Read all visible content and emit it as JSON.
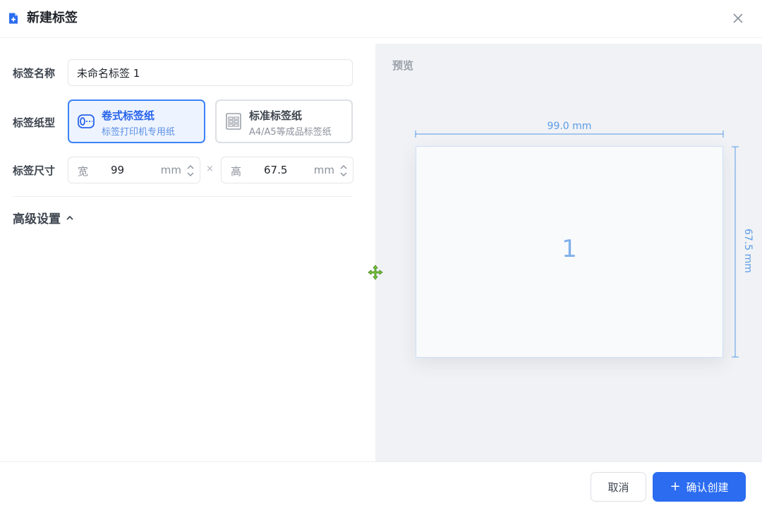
{
  "header": {
    "title": "新建标签",
    "icon": "add-file-icon",
    "close_icon": "close-icon"
  },
  "form": {
    "name_label": "标签名称",
    "name_value": "未命名标签 1",
    "paper_label": "标签纸型",
    "paper_options": [
      {
        "title": "卷式标签纸",
        "subtitle": "标签打印机专用纸",
        "icon": "roll-paper-icon",
        "selected": true
      },
      {
        "title": "标准标签纸",
        "subtitle": "A4/A5等成品标签纸",
        "icon": "sheet-paper-icon",
        "selected": false
      }
    ],
    "size_label": "标签尺寸",
    "width": {
      "prefix": "宽",
      "value": "99",
      "unit": "mm"
    },
    "separator": "×",
    "height": {
      "prefix": "高",
      "value": "67.5",
      "unit": "mm"
    },
    "advanced_label": "高级设置"
  },
  "preview": {
    "label": "预览",
    "width_text": "99.0 mm",
    "height_text": "67.5 mm",
    "label_number": "1"
  },
  "footer": {
    "cancel_label": "取消",
    "confirm_plus": "+",
    "confirm_label": "确认创建"
  },
  "colors": {
    "accent": "#2b6cf0",
    "selected_border": "#3b82f6",
    "dimension": "#5b9be8",
    "preview_bg": "#f0f2f5"
  }
}
